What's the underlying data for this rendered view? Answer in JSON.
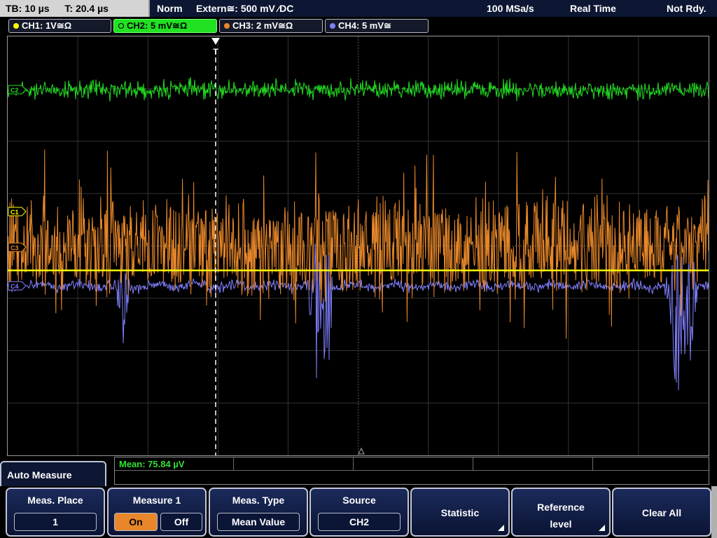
{
  "status": {
    "timebase": "TB: 10 µs",
    "trigger_time": "T: 20.4 µs",
    "mode": "Norm",
    "trigger_source": "Extern≅: 500 mV ⁄DC",
    "sample_rate": "100 MSa/s",
    "acquisition": "Real Time",
    "state": "Not Rdy."
  },
  "channels": [
    {
      "label": "CH1: 1V≅Ω",
      "color": "#ffff00",
      "active": false
    },
    {
      "label": "CH2: 5 mV≅Ω",
      "color": "#22e022",
      "active": true
    },
    {
      "label": "CH3: 2 mV≅Ω",
      "color": "#e7872a",
      "active": false
    },
    {
      "label": "CH4: 5 mV≅",
      "color": "#8080ff",
      "active": false
    }
  ],
  "markers": {
    "ch2": "C2",
    "ch1": "C1",
    "ch3": "C3",
    "ch4": "C4",
    "trigger": "T"
  },
  "measurement": {
    "mean": "Mean: 75.84 µV"
  },
  "menu": {
    "title": "Auto Measure",
    "softkeys": {
      "meas_place": {
        "label": "Meas. Place",
        "value": "1"
      },
      "measure1": {
        "label": "Measure 1",
        "on": "On",
        "off": "Off"
      },
      "meas_type": {
        "label": "Meas. Type",
        "value": "Mean Value"
      },
      "source": {
        "label": "Source",
        "value": "CH2"
      },
      "statistic": {
        "label": "Statistic"
      },
      "reference_level": {
        "line1": "Reference",
        "line2": "level"
      },
      "clear_all": {
        "label": "Clear All"
      }
    }
  },
  "colors": {
    "ch1": "#ffff00",
    "ch2": "#22e022",
    "ch3": "#e7872a",
    "ch4": "#8080ff",
    "grid": "#3a3a3a"
  }
}
